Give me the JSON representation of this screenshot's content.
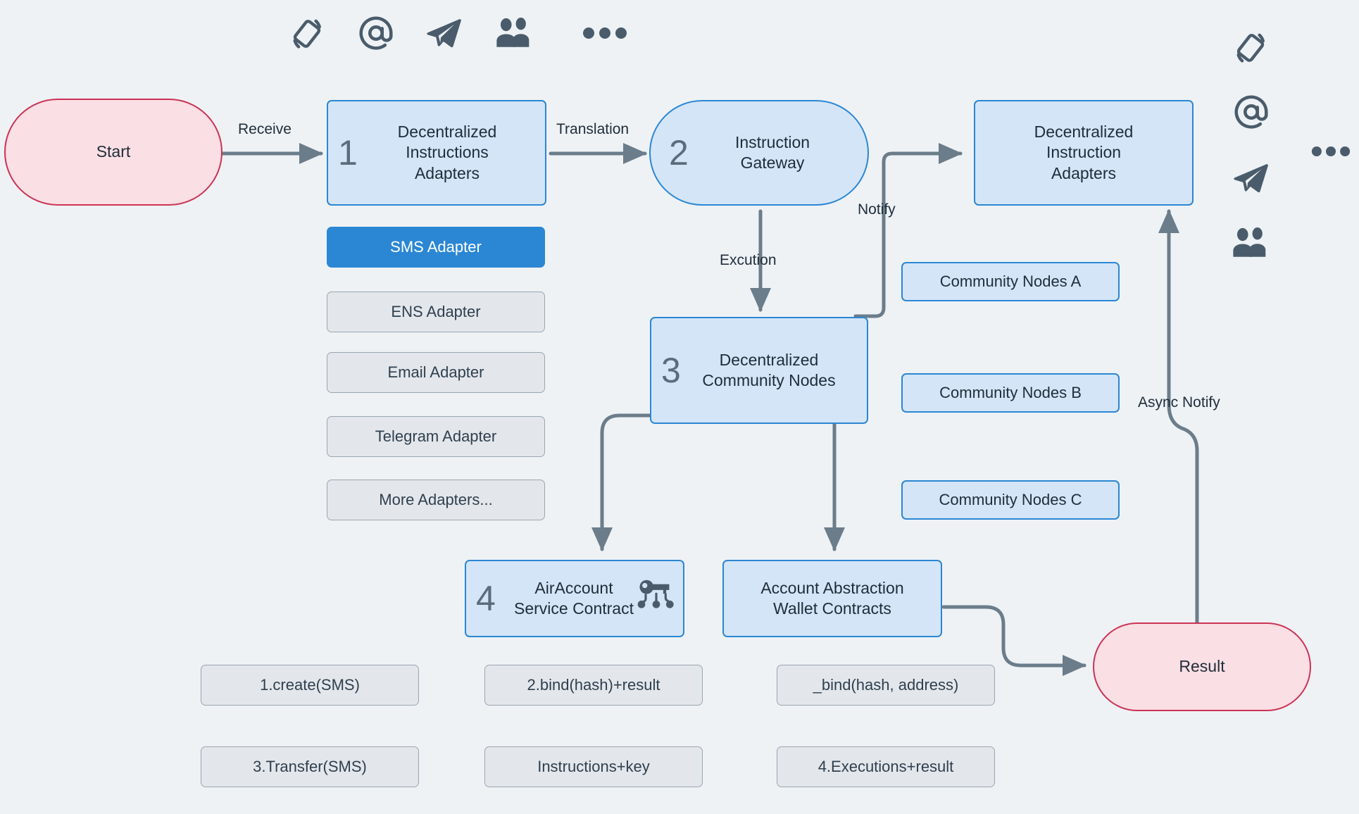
{
  "diagram": {
    "background_color": "#eef2f5",
    "accent_color": "#2b87d4",
    "node_fill_blue": "#d4e5f7",
    "node_fill_pink": "#fadfe4",
    "node_fill_gray": "#e3e7eb",
    "edge_color": "#6b7c8a",
    "terminal_border": "#cc3355"
  },
  "nodes": {
    "start": {
      "label": "Start"
    },
    "result": {
      "label": "Result"
    },
    "adapters_step": {
      "number": "1",
      "label": "Decentralized\nInstructions\nAdapters"
    },
    "gateway_step": {
      "number": "2",
      "label": "Instruction\nGateway"
    },
    "community_step": {
      "number": "3",
      "label": "Decentralized\nCommunity Nodes"
    },
    "airaccount_step": {
      "number": "4",
      "label": "AirAccount\nService Contract"
    },
    "instruction_adapters_out": {
      "label": "Decentralized\nInstruction\nAdapters"
    },
    "wallet_contracts": {
      "label": "Account Abstraction\nWallet Contracts"
    }
  },
  "adapter_list": [
    {
      "label": "SMS Adapter",
      "selected": true
    },
    {
      "label": "ENS Adapter",
      "selected": false
    },
    {
      "label": "Email Adapter",
      "selected": false
    },
    {
      "label": "Telegram Adapter",
      "selected": false
    },
    {
      "label": "More Adapters...",
      "selected": false
    }
  ],
  "community_nodes": [
    {
      "label": "Community Nodes A"
    },
    {
      "label": "Community Nodes B"
    },
    {
      "label": "Community Nodes C"
    }
  ],
  "call_labels": {
    "col1": [
      "1.create(SMS)",
      "3.Transfer(SMS)"
    ],
    "col2": [
      "2.bind(hash)+result",
      "Instructions+key"
    ],
    "col3": [
      "_bind(hash, address)",
      "4.Executions+result"
    ]
  },
  "edge_labels": {
    "receive": "Receive",
    "translation": "Translation",
    "notify": "Notify",
    "excution": "Excution",
    "async_notify": "Async Notify"
  },
  "icons": {
    "top_row": [
      "sms-rotate-icon",
      "at-sign-icon",
      "telegram-plane-icon",
      "community-people-icon",
      "more-dots-icon"
    ],
    "right_column": [
      "sms-rotate-icon",
      "at-sign-icon",
      "telegram-plane-icon",
      "community-people-icon",
      "more-dots-icon"
    ],
    "inline": [
      "key-share-icon"
    ]
  }
}
